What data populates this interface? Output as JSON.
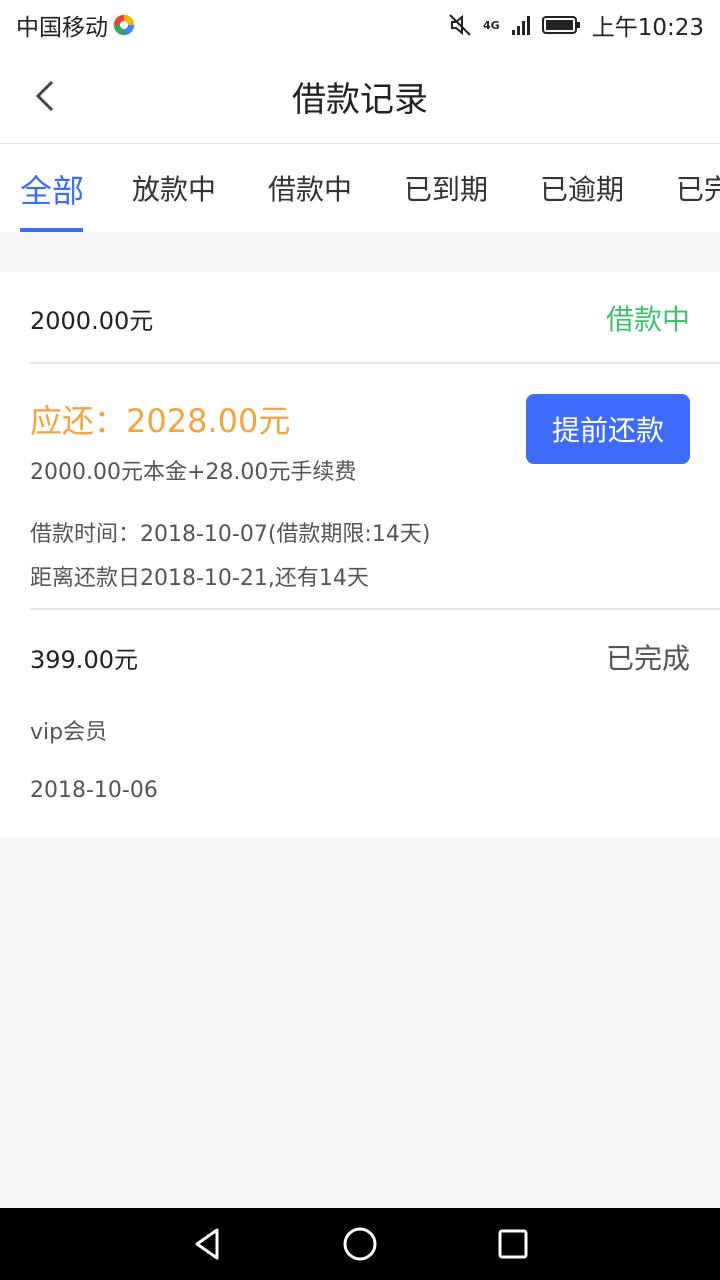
{
  "status_bar": {
    "carrier": "中国移动",
    "network": "4G",
    "time": "上午10:23"
  },
  "header": {
    "title": "借款记录",
    "back_icon": "chevron-left-icon"
  },
  "tabs": [
    {
      "label": "全部",
      "active": true
    },
    {
      "label": "放款中",
      "active": false
    },
    {
      "label": "借款中",
      "active": false
    },
    {
      "label": "已到期",
      "active": false
    },
    {
      "label": "已逾期",
      "active": false
    },
    {
      "label": "已完",
      "active": false
    }
  ],
  "records": [
    {
      "amount": "2000.00元",
      "status": "借款中",
      "due": "应还：2028.00元",
      "breakdown": "2000.00元本金+28.00元手续费",
      "loan_time": "借款时间：2018-10-07(借款期限:14天)",
      "countdown": "距离还款日2018-10-21,还有14天",
      "button": "提前还款"
    },
    {
      "amount": "399.00元",
      "status": "已完成",
      "description": "vip会员",
      "date": "2018-10-06"
    }
  ],
  "colors": {
    "accent": "#3a6ef5",
    "status_active": "#3cc36b",
    "due_amount": "#f5a442"
  }
}
